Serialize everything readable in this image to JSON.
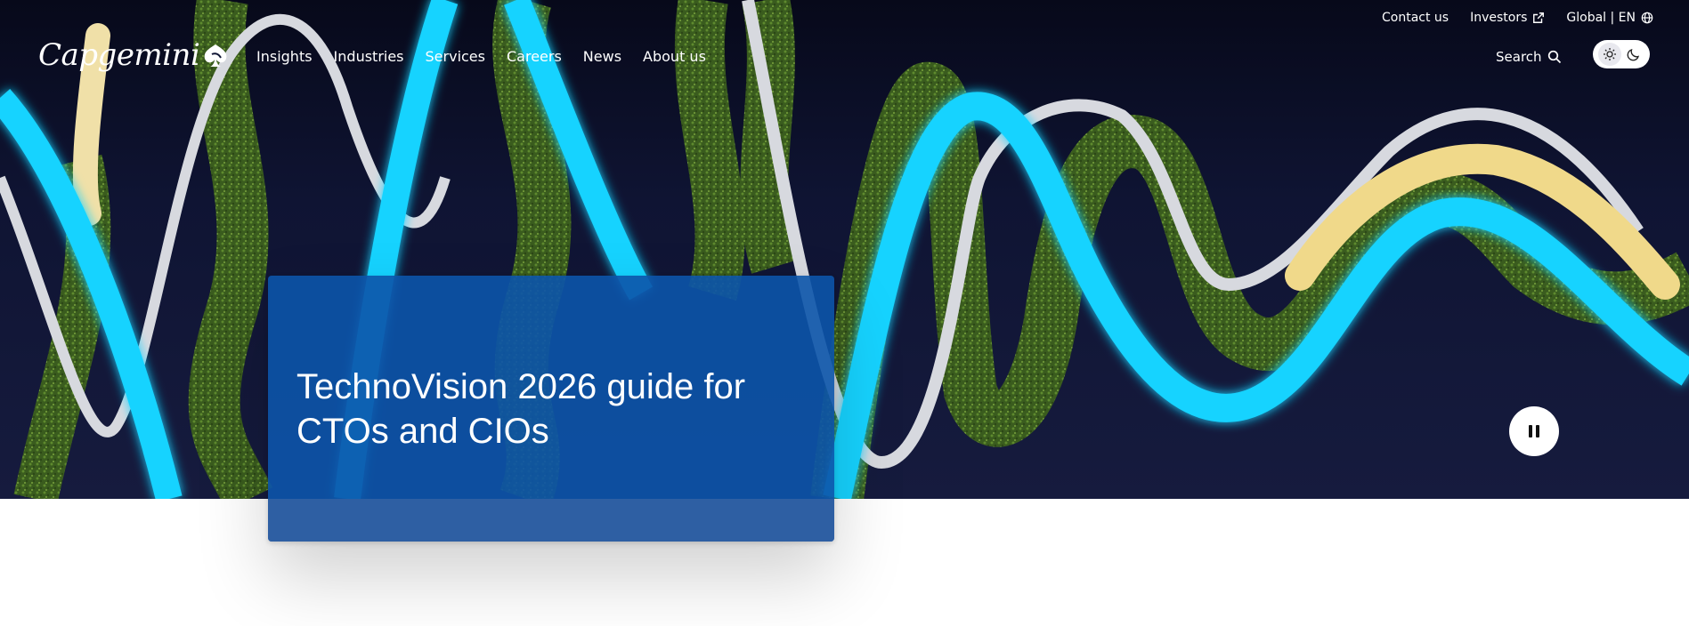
{
  "utility_nav": {
    "contact_label": "Contact us",
    "investors_label": "Investors",
    "locale_label": "Global | EN"
  },
  "brand": {
    "logo_text": "Capgemini"
  },
  "main_nav": {
    "items": [
      {
        "label": "Insights"
      },
      {
        "label": "Industries"
      },
      {
        "label": "Services"
      },
      {
        "label": "Careers"
      },
      {
        "label": "News"
      },
      {
        "label": "About us"
      }
    ],
    "search_label": "Search"
  },
  "theme_toggle": {
    "selected": "light",
    "options": [
      "sun-icon",
      "moon-icon"
    ]
  },
  "hero": {
    "card_title": "TechnoVision 2026 guide for CTOs and CIOs",
    "card_color": "#0c54aa",
    "media_state": "playing"
  },
  "colors": {
    "hero_bg": "#0f1433",
    "neon_cyan": "#19d3ff",
    "silver": "#cfd2d8",
    "gold": "#f0d98a",
    "moss": "#3f6420"
  }
}
